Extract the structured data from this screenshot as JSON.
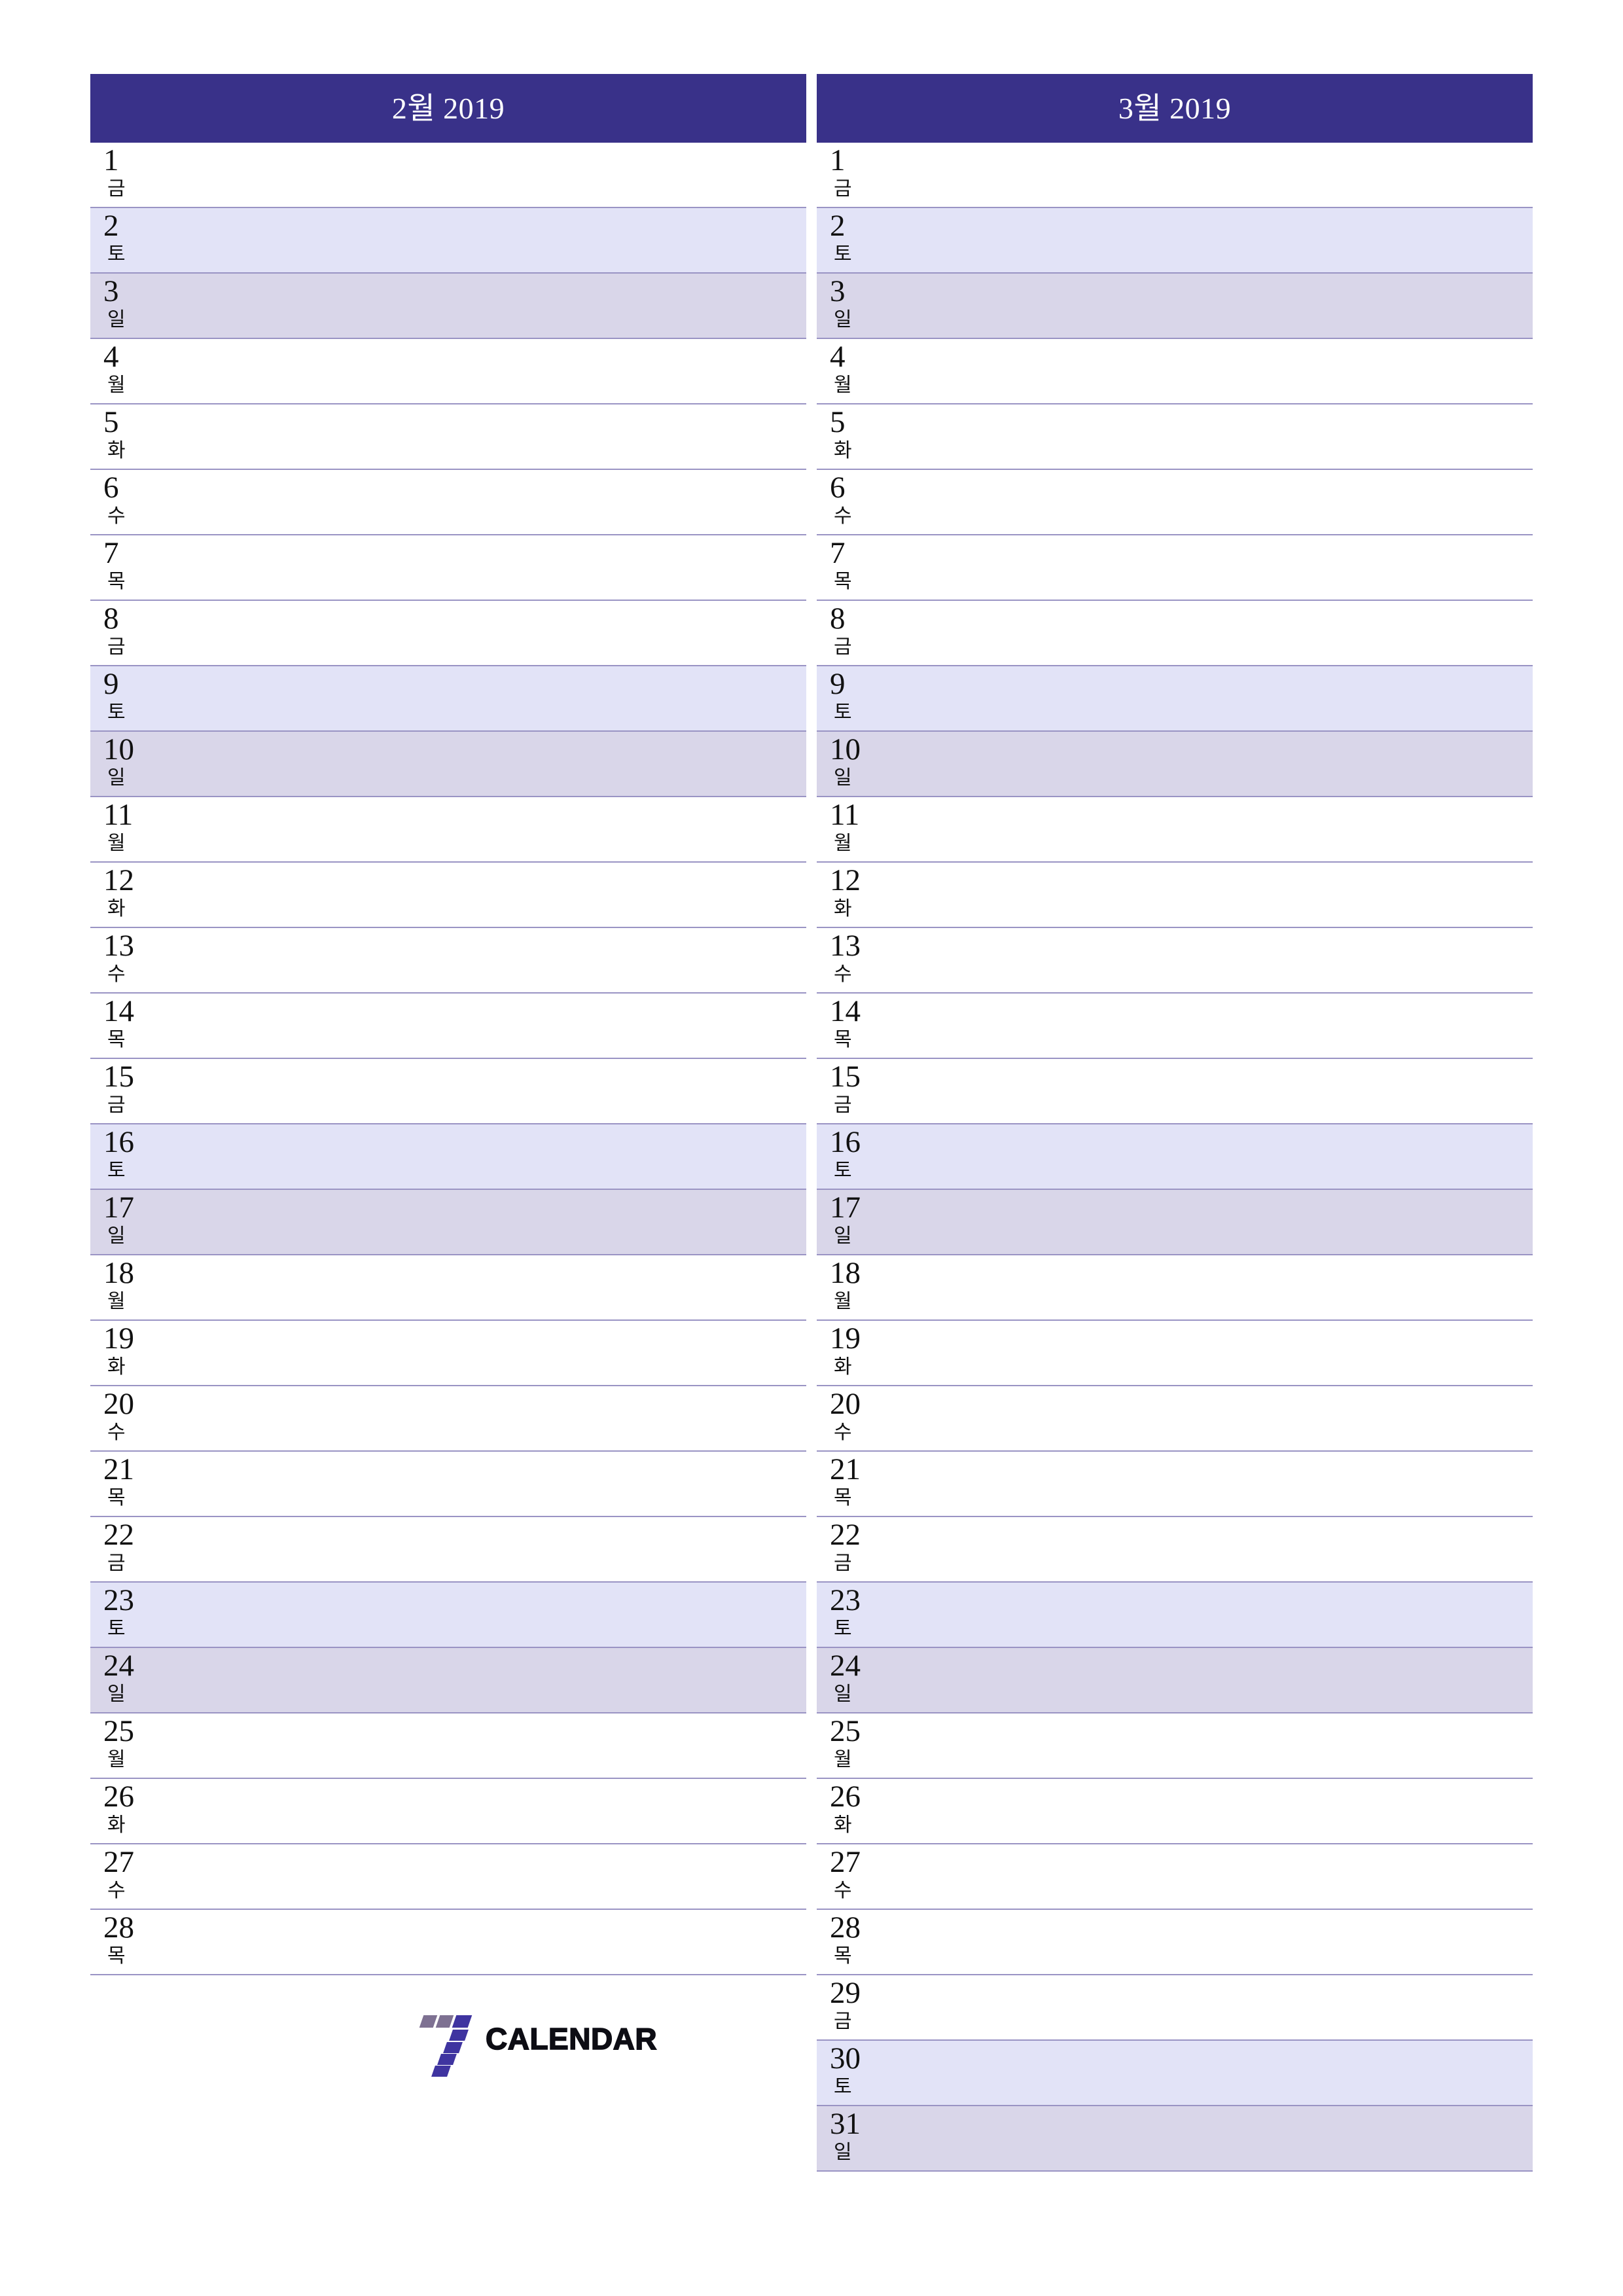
{
  "document": {
    "type": "monthly-planner",
    "language": "ko",
    "page_size": "A4-portrait"
  },
  "colors": {
    "header_purple": "#393189",
    "saturday_bg": "#e2e3f7",
    "sunday_bg": "#d9d6e9",
    "row_divider": "#9a94c4",
    "logo_gray": "#7e7192",
    "logo_blue": "#3f34a0",
    "logo_text": "#0d0d14"
  },
  "weekdays": {
    "mon": "월",
    "tue": "화",
    "wed": "수",
    "thu": "목",
    "fri": "금",
    "sat": "토",
    "sun": "일"
  },
  "months": [
    {
      "title": "2월 2019",
      "name": "2월",
      "year": "2019",
      "month_number": 2,
      "days_in_month": 28,
      "days": [
        {
          "num": "1",
          "wd": "금",
          "kind": "weekday"
        },
        {
          "num": "2",
          "wd": "토",
          "kind": "sat"
        },
        {
          "num": "3",
          "wd": "일",
          "kind": "sun"
        },
        {
          "num": "4",
          "wd": "월",
          "kind": "weekday"
        },
        {
          "num": "5",
          "wd": "화",
          "kind": "weekday"
        },
        {
          "num": "6",
          "wd": "수",
          "kind": "weekday"
        },
        {
          "num": "7",
          "wd": "목",
          "kind": "weekday"
        },
        {
          "num": "8",
          "wd": "금",
          "kind": "weekday"
        },
        {
          "num": "9",
          "wd": "토",
          "kind": "sat"
        },
        {
          "num": "10",
          "wd": "일",
          "kind": "sun"
        },
        {
          "num": "11",
          "wd": "월",
          "kind": "weekday"
        },
        {
          "num": "12",
          "wd": "화",
          "kind": "weekday"
        },
        {
          "num": "13",
          "wd": "수",
          "kind": "weekday"
        },
        {
          "num": "14",
          "wd": "목",
          "kind": "weekday"
        },
        {
          "num": "15",
          "wd": "금",
          "kind": "weekday"
        },
        {
          "num": "16",
          "wd": "토",
          "kind": "sat"
        },
        {
          "num": "17",
          "wd": "일",
          "kind": "sun"
        },
        {
          "num": "18",
          "wd": "월",
          "kind": "weekday"
        },
        {
          "num": "19",
          "wd": "화",
          "kind": "weekday"
        },
        {
          "num": "20",
          "wd": "수",
          "kind": "weekday"
        },
        {
          "num": "21",
          "wd": "목",
          "kind": "weekday"
        },
        {
          "num": "22",
          "wd": "금",
          "kind": "weekday"
        },
        {
          "num": "23",
          "wd": "토",
          "kind": "sat"
        },
        {
          "num": "24",
          "wd": "일",
          "kind": "sun"
        },
        {
          "num": "25",
          "wd": "월",
          "kind": "weekday"
        },
        {
          "num": "26",
          "wd": "화",
          "kind": "weekday"
        },
        {
          "num": "27",
          "wd": "수",
          "kind": "weekday"
        },
        {
          "num": "28",
          "wd": "목",
          "kind": "weekday"
        }
      ]
    },
    {
      "title": "3월 2019",
      "name": "3월",
      "year": "2019",
      "month_number": 3,
      "days_in_month": 31,
      "days": [
        {
          "num": "1",
          "wd": "금",
          "kind": "weekday"
        },
        {
          "num": "2",
          "wd": "토",
          "kind": "sat"
        },
        {
          "num": "3",
          "wd": "일",
          "kind": "sun"
        },
        {
          "num": "4",
          "wd": "월",
          "kind": "weekday"
        },
        {
          "num": "5",
          "wd": "화",
          "kind": "weekday"
        },
        {
          "num": "6",
          "wd": "수",
          "kind": "weekday"
        },
        {
          "num": "7",
          "wd": "목",
          "kind": "weekday"
        },
        {
          "num": "8",
          "wd": "금",
          "kind": "weekday"
        },
        {
          "num": "9",
          "wd": "토",
          "kind": "sat"
        },
        {
          "num": "10",
          "wd": "일",
          "kind": "sun"
        },
        {
          "num": "11",
          "wd": "월",
          "kind": "weekday"
        },
        {
          "num": "12",
          "wd": "화",
          "kind": "weekday"
        },
        {
          "num": "13",
          "wd": "수",
          "kind": "weekday"
        },
        {
          "num": "14",
          "wd": "목",
          "kind": "weekday"
        },
        {
          "num": "15",
          "wd": "금",
          "kind": "weekday"
        },
        {
          "num": "16",
          "wd": "토",
          "kind": "sat"
        },
        {
          "num": "17",
          "wd": "일",
          "kind": "sun"
        },
        {
          "num": "18",
          "wd": "월",
          "kind": "weekday"
        },
        {
          "num": "19",
          "wd": "화",
          "kind": "weekday"
        },
        {
          "num": "20",
          "wd": "수",
          "kind": "weekday"
        },
        {
          "num": "21",
          "wd": "목",
          "kind": "weekday"
        },
        {
          "num": "22",
          "wd": "금",
          "kind": "weekday"
        },
        {
          "num": "23",
          "wd": "토",
          "kind": "sat"
        },
        {
          "num": "24",
          "wd": "일",
          "kind": "sun"
        },
        {
          "num": "25",
          "wd": "월",
          "kind": "weekday"
        },
        {
          "num": "26",
          "wd": "화",
          "kind": "weekday"
        },
        {
          "num": "27",
          "wd": "수",
          "kind": "weekday"
        },
        {
          "num": "28",
          "wd": "목",
          "kind": "weekday"
        },
        {
          "num": "29",
          "wd": "금",
          "kind": "weekday"
        },
        {
          "num": "30",
          "wd": "토",
          "kind": "sat"
        },
        {
          "num": "31",
          "wd": "일",
          "kind": "sun"
        }
      ]
    }
  ],
  "logo": {
    "mark": "seven-digit-logo",
    "text": "CALENDAR"
  }
}
